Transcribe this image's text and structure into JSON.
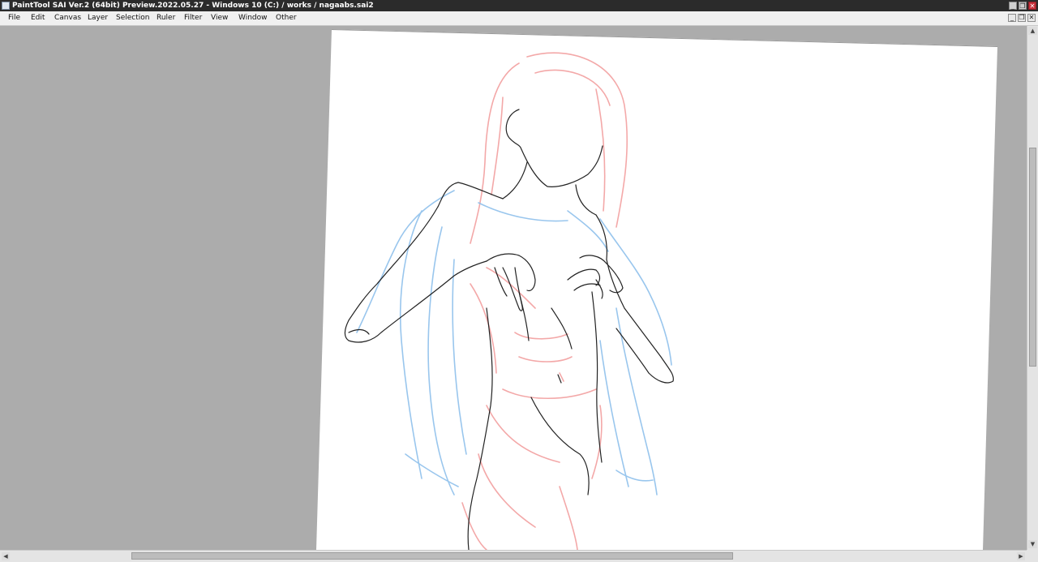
{
  "window": {
    "title": "PaintTool SAI Ver.2 (64bit) Preview.2022.05.27 - Windows 10 (C:) / works / nagaabs.sai2",
    "minimize_glyph": "_",
    "restore_glyph": "❐",
    "close_glyph": "✕"
  },
  "menu": {
    "items": [
      "File",
      "Edit",
      "Canvas",
      "Layer",
      "Selection",
      "Ruler",
      "Filter",
      "View",
      "Window",
      "Other"
    ],
    "doc_minimize_glyph": "_",
    "doc_restore_glyph": "❐",
    "doc_close_glyph": "✕"
  },
  "scrollbars": {
    "up_arrow": "▲",
    "down_arrow": "▼",
    "left_arrow": "◀",
    "right_arrow": "▶"
  },
  "colors": {
    "workspace": "#acacac",
    "paper": "#ffffff",
    "line_art": "#222222",
    "red_sketch": "#f29a9a",
    "blue_sketch": "#8fc0ec"
  }
}
